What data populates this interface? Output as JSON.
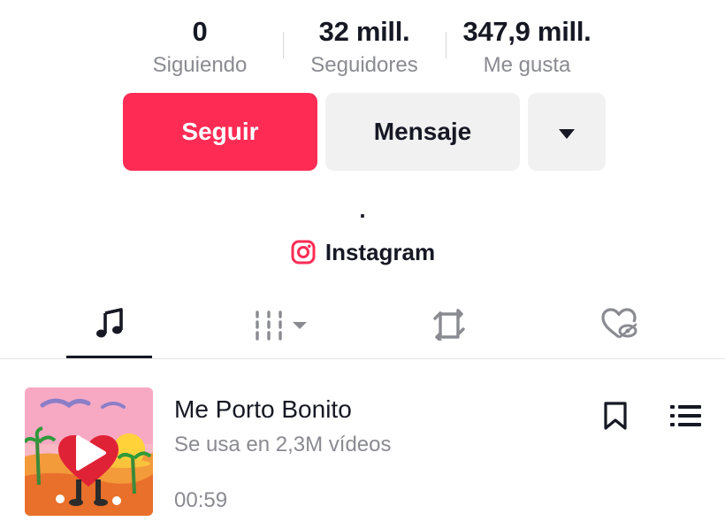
{
  "stats": {
    "following": {
      "value": "0",
      "label": "Siguiendo"
    },
    "followers": {
      "value": "32 mill.",
      "label": "Seguidores"
    },
    "likes": {
      "value": "347,9 mill.",
      "label": "Me gusta"
    }
  },
  "actions": {
    "follow_label": "Seguir",
    "message_label": "Mensaje",
    "more_icon": "caret-down-icon"
  },
  "bio": ".",
  "link": {
    "icon": "instagram-icon",
    "label": "Instagram"
  },
  "tabs": [
    {
      "icon": "music-note-icon",
      "active": true
    },
    {
      "icon": "videos-grid-icon",
      "active": false
    },
    {
      "icon": "repost-icon",
      "active": false
    },
    {
      "icon": "liked-hidden-icon",
      "active": false
    }
  ],
  "sound": {
    "title": "Me Porto Bonito",
    "usage": "Se usa en 2,3M vídeos",
    "duration": "00:59",
    "cover_icon": "play-icon",
    "actions": [
      "bookmark-icon",
      "list-icon"
    ]
  },
  "colors": {
    "accent": "#fe2c55",
    "text_primary": "#161823",
    "text_secondary": "#8a8b91",
    "button_secondary_bg": "#f1f1f2"
  }
}
